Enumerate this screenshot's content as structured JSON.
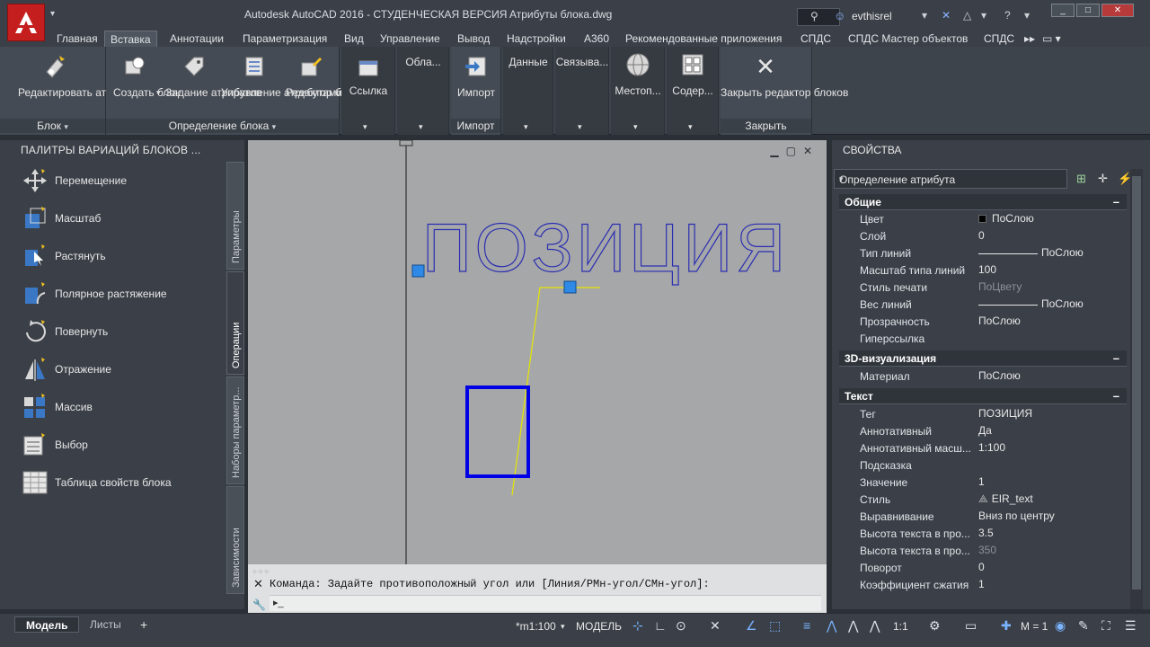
{
  "title": {
    "app": "Autodesk AutoCAD 2016 - СТУДЕНЧЕСКАЯ ВЕРСИЯ",
    "file": "Атрибуты блока.dwg",
    "user": "evthisrel"
  },
  "ribbon_tabs": [
    "Главная",
    "Вставка",
    "Аннотации",
    "Параметризация",
    "Вид",
    "Управление",
    "Вывод",
    "Надстройки",
    "A360",
    "Рекомендованные приложения",
    "СПДС",
    "СПДС Мастер объектов",
    "СПДС"
  ],
  "ribbon": {
    "edit_attr": "Редактировать атрибут",
    "panel_block": "Блок",
    "create_block": "Создать блок",
    "define_attr": "Задание атрибутов",
    "manage_attr": "Управление атрибутами",
    "block_editor": "Редактор блоков",
    "panel_block_def": "Определение блока",
    "reference": "Ссылка",
    "clouds": "Обла...",
    "import": "Импорт",
    "panel_import": "Импорт",
    "data": "Данные",
    "link": "Связыва...",
    "location": "Местоп...",
    "contents": "Содер...",
    "close_editor": "Закрыть редактор блоков",
    "panel_close": "Закрыть"
  },
  "palette": {
    "title": "ПАЛИТРЫ ВАРИАЦИЙ БЛОКОВ ...",
    "items": [
      "Перемещение",
      "Масштаб",
      "Растянуть",
      "Полярное растяжение",
      "Повернуть",
      "Отражение",
      "Массив",
      "Выбор",
      "Таблица свойств блока"
    ],
    "vtabs": [
      "Параметры",
      "Операции",
      "Наборы параметр...",
      "Зависимости"
    ]
  },
  "canvas": {
    "attribute_text": "ПОЗИЦИЯ"
  },
  "command": {
    "line": "Команда: Задайте противоположный угол или [Линия/РМн-угол/СМн-угол]:"
  },
  "properties": {
    "title": "СВОЙСТВА",
    "selector": "Определение атрибута",
    "sections": {
      "general": "Общие",
      "viz3d": "3D-визуализация",
      "text": "Текст"
    },
    "general": [
      {
        "k": "Цвет",
        "v": "ПоСлою"
      },
      {
        "k": "Слой",
        "v": "0"
      },
      {
        "k": "Тип линий",
        "v": "ПоСлою"
      },
      {
        "k": "Масштаб типа линий",
        "v": "100"
      },
      {
        "k": "Стиль печати",
        "v": "ПоЦвету"
      },
      {
        "k": "Вес линий",
        "v": "ПоСлою"
      },
      {
        "k": "Прозрачность",
        "v": "ПоСлою"
      },
      {
        "k": "Гиперссылка",
        "v": ""
      }
    ],
    "viz3d": [
      {
        "k": "Материал",
        "v": "ПоСлою"
      }
    ],
    "text": [
      {
        "k": "Тег",
        "v": "ПОЗИЦИЯ"
      },
      {
        "k": "Аннотативный",
        "v": "Да"
      },
      {
        "k": "Аннотативный масш...",
        "v": "1:100"
      },
      {
        "k": "Подсказка",
        "v": ""
      },
      {
        "k": "Значение",
        "v": "1"
      },
      {
        "k": "Стиль",
        "v": "EIR_text"
      },
      {
        "k": "Выравнивание",
        "v": "Вниз по центру"
      },
      {
        "k": "Высота текста в про...",
        "v": "3.5"
      },
      {
        "k": "Высота текста в про...",
        "v": "350"
      },
      {
        "k": "Поворот",
        "v": "0"
      },
      {
        "k": "Коэффициент сжатия",
        "v": "1"
      }
    ]
  },
  "status": {
    "tab_model": "Модель",
    "tab_sheets": "Листы",
    "add": "+",
    "scale": "*m1:100",
    "model": "МОДЕЛЬ",
    "anno_scale": "1:1",
    "m1": "M = 1"
  },
  "colors": {
    "accent": "#c41e1e",
    "block_rect": "#0000e6",
    "grip": "#2e8ae6",
    "leader": "#e6e600"
  }
}
